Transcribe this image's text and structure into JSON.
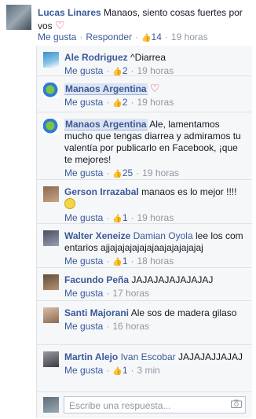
{
  "main": {
    "author": "Lucas Linares",
    "text": "Manaos, siento cosas fuertes por vos",
    "like_label": "Me gusta",
    "reply_label": "Responder",
    "likes": "14",
    "time": "19 horas"
  },
  "replies": [
    {
      "author": "Ale Rodriguez",
      "text": "^Diarrea",
      "likes": "2",
      "time": "19 horas",
      "like_label": "Me gusta"
    },
    {
      "author": "Manaos Argentina",
      "text": "",
      "likes": "2",
      "time": "19 horas",
      "like_label": "Me gusta"
    },
    {
      "author": "Manaos Argentina",
      "text": "Ale, lamentamos mucho que tengas diarrea y admiramos tu valentía por publicarlo en Facebook, ¡que te mejores!",
      "likes": "25",
      "time": "19 horas",
      "like_label": "Me gusta"
    },
    {
      "author": "Gerson Irrazabal",
      "text": "manaos es lo mejor !!!!",
      "likes": "1",
      "time": "19 horas",
      "like_label": "Me gusta"
    },
    {
      "author": "Walter Xeneize",
      "mention": "Damian Oyola",
      "text": "lee los comentarios ajjajajajajajajaajajajajajaj",
      "likes": "1",
      "time": "18 horas",
      "like_label": "Me gusta"
    },
    {
      "author": "Facundo Peña",
      "text": "JAJAJAJAJAJAJAJ",
      "time": "17 horas",
      "like_label": "Me gusta"
    },
    {
      "author": "Santi Majorani",
      "text": "Ale sos de madera gilaso",
      "time": "16 horas",
      "like_label": "Me gusta"
    },
    {
      "author": "Martin Alejo",
      "mention": "Ivan Escobar",
      "text": "JAJAJAJJAJAJ",
      "likes": "1",
      "time": "3 min",
      "like_label": "Me gusta"
    }
  ],
  "composer": {
    "placeholder": "Escribe una respuesta..."
  }
}
